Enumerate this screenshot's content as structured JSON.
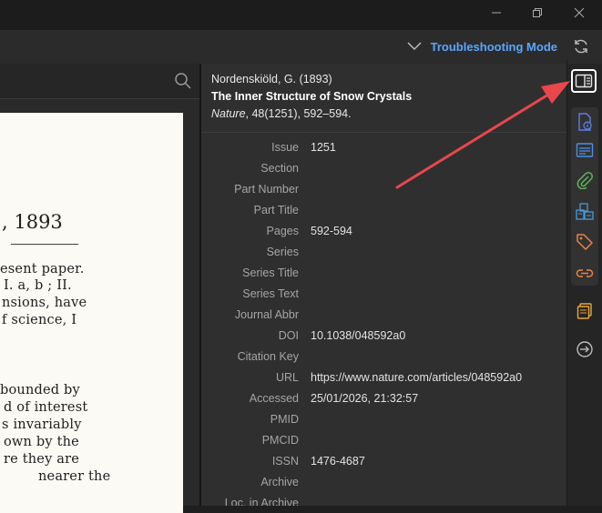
{
  "toolbar": {
    "mode_label": "Troubleshooting Mode"
  },
  "window_controls": [
    "minimize-icon",
    "restore-icon",
    "close-icon"
  ],
  "reader": {
    "year_line": ", 1893",
    "lines": [
      "esent paper.",
      "I. a, b ; II.",
      "nsions, have",
      "f science, I",
      "bounded by",
      "d of interest",
      "s invariably",
      "own by the",
      "re they are",
      "nearer the"
    ]
  },
  "item": {
    "authors_year": "Nordenskiöld, G. (1893)",
    "title": "The Inner Structure of Snow Crystals",
    "citation": "Nature, 48(1251), 592–594.",
    "citation_journal": "Nature",
    "citation_rest": ", 48(1251), 592–594.",
    "fields": [
      {
        "label": "Issue",
        "value": "1251"
      },
      {
        "label": "Section",
        "value": ""
      },
      {
        "label": "Part Number",
        "value": ""
      },
      {
        "label": "Part Title",
        "value": ""
      },
      {
        "label": "Pages",
        "value": "592-594"
      },
      {
        "label": "Series",
        "value": ""
      },
      {
        "label": "Series Title",
        "value": ""
      },
      {
        "label": "Series Text",
        "value": ""
      },
      {
        "label": "Journal Abbr",
        "value": ""
      },
      {
        "label": "DOI",
        "value": "10.1038/048592a0"
      },
      {
        "label": "Citation Key",
        "value": ""
      },
      {
        "label": "URL",
        "value": "https://www.nature.com/articles/048592a0"
      },
      {
        "label": "Accessed",
        "value": "25/01/2026, 21:32:57"
      },
      {
        "label": "PMID",
        "value": ""
      },
      {
        "label": "PMCID",
        "value": ""
      },
      {
        "label": "ISSN",
        "value": "1476-4687"
      },
      {
        "label": "Archive",
        "value": ""
      },
      {
        "label": "Loc. in Archive",
        "value": ""
      }
    ]
  },
  "sidebar_icons": [
    "toggle-pane-icon",
    "info-icon",
    "abstract-icon",
    "attachments-icon",
    "libraries-collections-icon",
    "tags-icon",
    "related-icon",
    "notes-icon",
    "locate-icon"
  ],
  "colors": {
    "accent": "#5aa6ff",
    "arrow": "#e8474c",
    "info_icon": "#5b7fe6",
    "abstract_icon": "#4a8ee8",
    "attachment_icon": "#5cb85c",
    "library_icon": "#4a9ad8",
    "tag_icon": "#e8844a",
    "related_icon": "#e8844a",
    "notes_icon": "#e8a73a"
  }
}
